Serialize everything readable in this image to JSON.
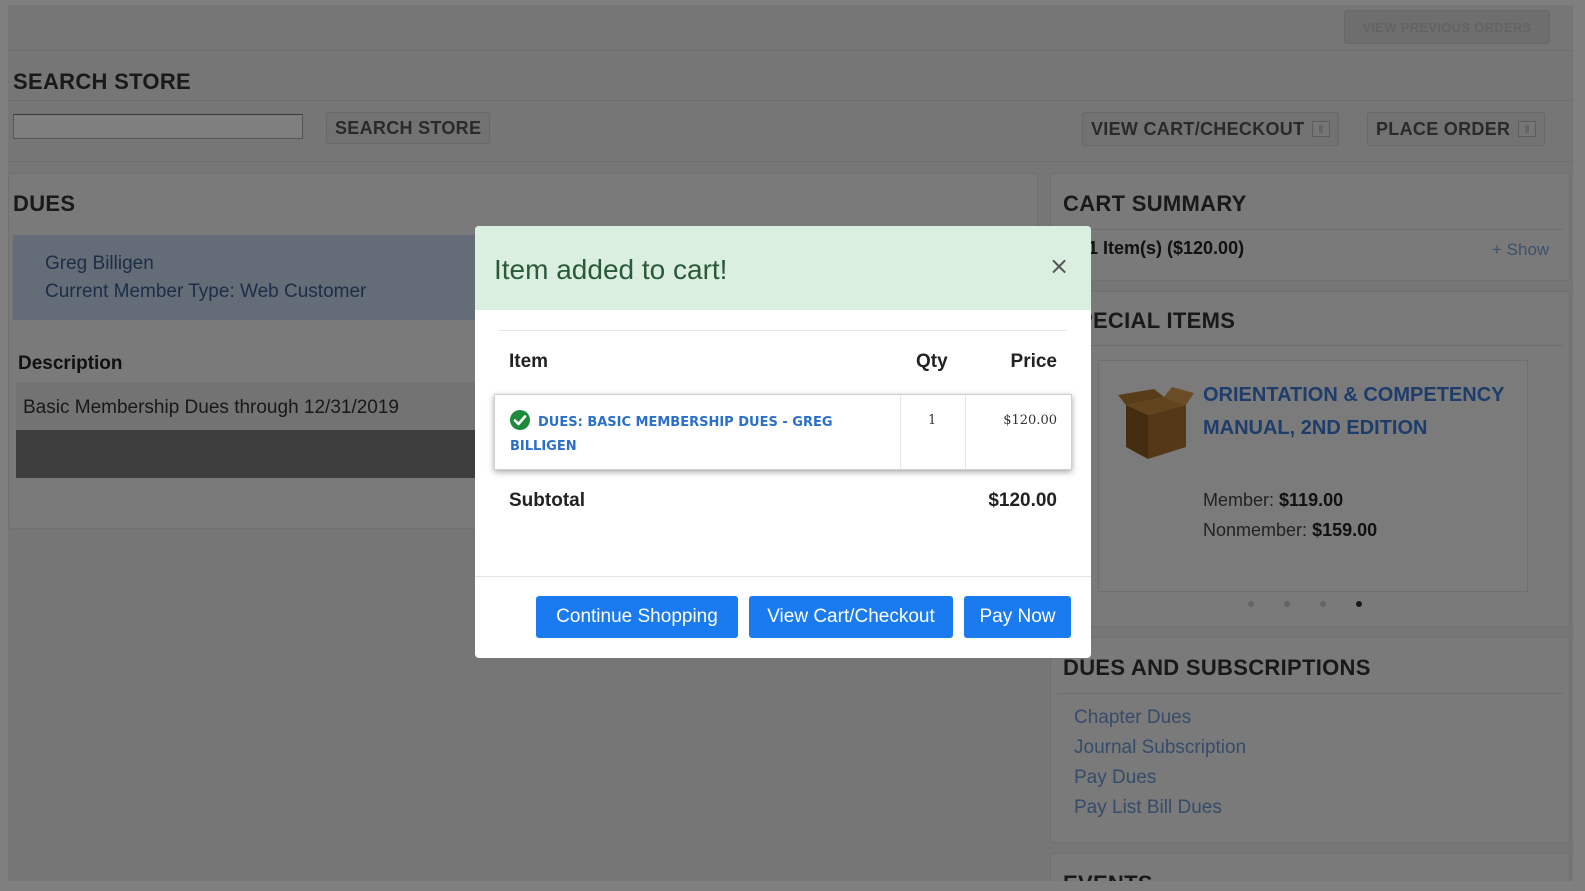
{
  "header": {
    "view_previous_orders": "VIEW PREVIOUS ORDERS"
  },
  "search": {
    "title": "SEARCH STORE",
    "input_value": "",
    "button_label": "SEARCH STORE"
  },
  "toolbar": {
    "view_cart_label": "VIEW CART/CHECKOUT",
    "place_order_label": "PLACE ORDER"
  },
  "dues": {
    "title": "DUES",
    "member_name": "Greg Billigen",
    "member_type": "Current Member Type: Web Customer",
    "table_header": "Description",
    "rows": [
      "Basic Membership Dues through 12/31/2019"
    ]
  },
  "cart_summary": {
    "title": "CART SUMMARY",
    "items_text": "1 Item(s) ($120.00)",
    "show_label": "+ Show"
  },
  "special_items": {
    "title": "SPECIAL ITEMS",
    "product_title": "ORIENTATION & COMPETENCY MANUAL, 2ND EDITION",
    "member_label": "Member:",
    "member_price": "$119.00",
    "nonmember_label": "Nonmember:",
    "nonmember_price": "$159.00",
    "carousel_active_index": 3,
    "carousel_count": 4
  },
  "dues_subscriptions": {
    "title": "DUES AND SUBSCRIPTIONS",
    "links": [
      "Chapter Dues",
      "Journal Subscription",
      "Pay Dues",
      "Pay List Bill Dues"
    ]
  },
  "events": {
    "title": "EVENTS"
  },
  "modal": {
    "title": "Item added to cart!",
    "close_symbol": "×",
    "col_item": "Item",
    "col_qty": "Qty",
    "col_price": "Price",
    "item_name": "DUES: BASIC MEMBERSHIP DUES - GREG BILLIGEN",
    "item_qty": "1",
    "item_price": "$120.00",
    "subtotal_label": "Subtotal",
    "subtotal_value": "$120.00",
    "continue_label": "Continue Shopping",
    "view_cart_label": "View Cart/Checkout",
    "pay_now_label": "Pay Now"
  },
  "colors": {
    "accent_blue": "#1a7bf0",
    "link_blue": "#2a6fc9",
    "success_green": "#1e8a3c",
    "modal_header_bg": "#dbefe0"
  },
  "icons": {
    "check": "check-circle-icon",
    "close": "close-icon",
    "cart": "cart-icon",
    "product": "box-icon"
  }
}
